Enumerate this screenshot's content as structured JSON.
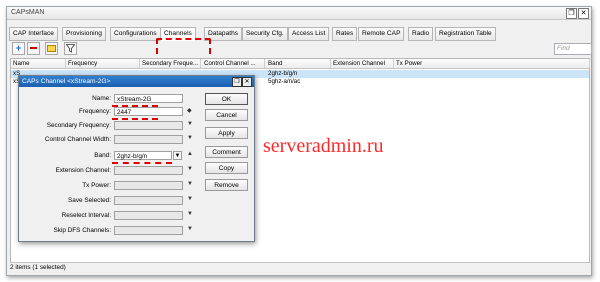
{
  "window": {
    "title": "CAPsMAN",
    "restore_glyph": "❐",
    "close_glyph": "✕"
  },
  "tabs": [
    "CAP Interface",
    "Provisioning",
    "Configurations",
    "Channels",
    "Datapaths",
    "Security Cfg.",
    "Access List",
    "Rates",
    "Remote CAP",
    "Radio",
    "Registration Table"
  ],
  "active_tab": "Channels",
  "toolbar": {
    "add_icon": "plus-icon",
    "remove_icon": "minus-icon",
    "comment_icon": "comment-icon",
    "filter_icon": "filter-icon",
    "find_placeholder": "Find"
  },
  "grid": {
    "columns": [
      "Name",
      "Frequency",
      "Secondary Freque...",
      "Control Channel ...",
      "Band",
      "Extension Channel",
      "Tx Power"
    ],
    "rows": [
      {
        "name": "xS",
        "band": "2ghz-b/g/n",
        "selected": true
      },
      {
        "name": "xS",
        "band": "5ghz-a/n/ac",
        "selected": false
      }
    ]
  },
  "status": "2 items (1 selected)",
  "watermark": "serveradmin.ru",
  "dialog": {
    "title": "CAPs Channel <xStream-2G>",
    "fields": {
      "name_label": "Name:",
      "name_value": "xStream-2G",
      "frequency_label": "Frequency:",
      "frequency_value": "2447",
      "secondary_frequency_label": "Secondary Frequency:",
      "control_channel_width_label": "Control Channel Width:",
      "band_label": "Band:",
      "band_value": "2ghz-b/g/n",
      "extension_channel_label": "Extension Channel:",
      "tx_power_label": "Tx Power:",
      "save_selected_label": "Save Selected:",
      "reselect_interval_label": "Reselect Interval:",
      "skip_dfs_channels_label": "Skip DFS Channels:"
    },
    "buttons": {
      "ok": "OK",
      "cancel": "Cancel",
      "apply": "Apply",
      "comment": "Comment",
      "copy": "Copy",
      "remove": "Remove"
    }
  },
  "colors": {
    "highlight": "#e00000",
    "selection": "#cce4f7",
    "dialog_title": "#1c5fb0"
  }
}
